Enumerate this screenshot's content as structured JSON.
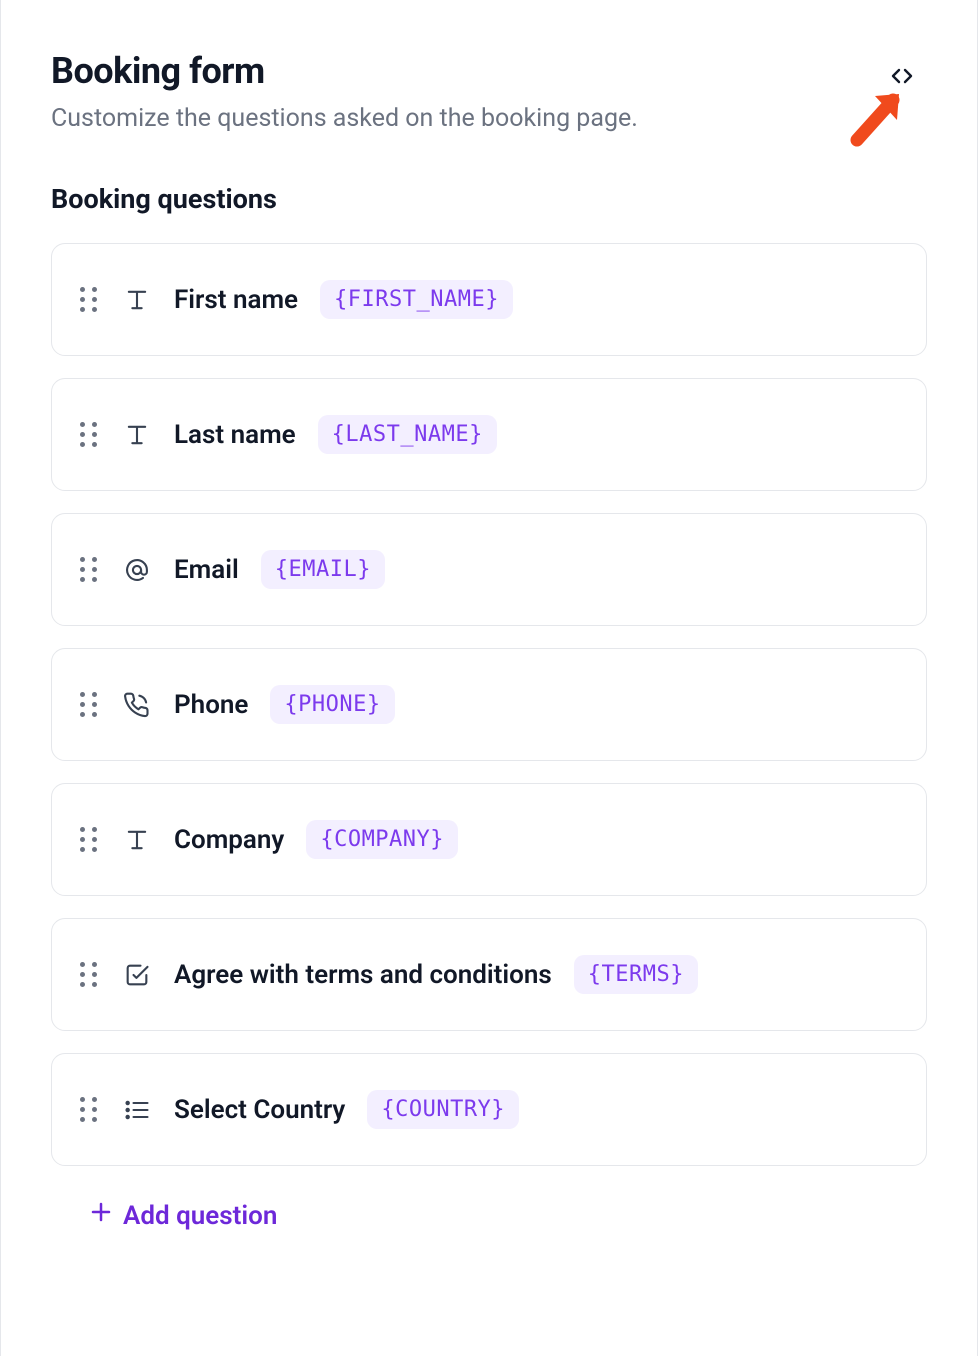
{
  "header": {
    "title": "Booking form",
    "subtitle": "Customize the questions asked on the booking page."
  },
  "section_heading": "Booking questions",
  "questions": [
    {
      "label": "First name",
      "tag": "{FIRST_NAME}",
      "icon": "text"
    },
    {
      "label": "Last name",
      "tag": "{LAST_NAME}",
      "icon": "text"
    },
    {
      "label": "Email",
      "tag": "{EMAIL}",
      "icon": "at"
    },
    {
      "label": "Phone",
      "tag": "{PHONE}",
      "icon": "phone"
    },
    {
      "label": "Company",
      "tag": "{COMPANY}",
      "icon": "text"
    },
    {
      "label": "Agree with terms and conditions",
      "tag": "{TERMS}",
      "icon": "checkbox"
    },
    {
      "label": "Select Country",
      "tag": "{COUNTRY}",
      "icon": "list"
    }
  ],
  "add_question_label": "Add question"
}
